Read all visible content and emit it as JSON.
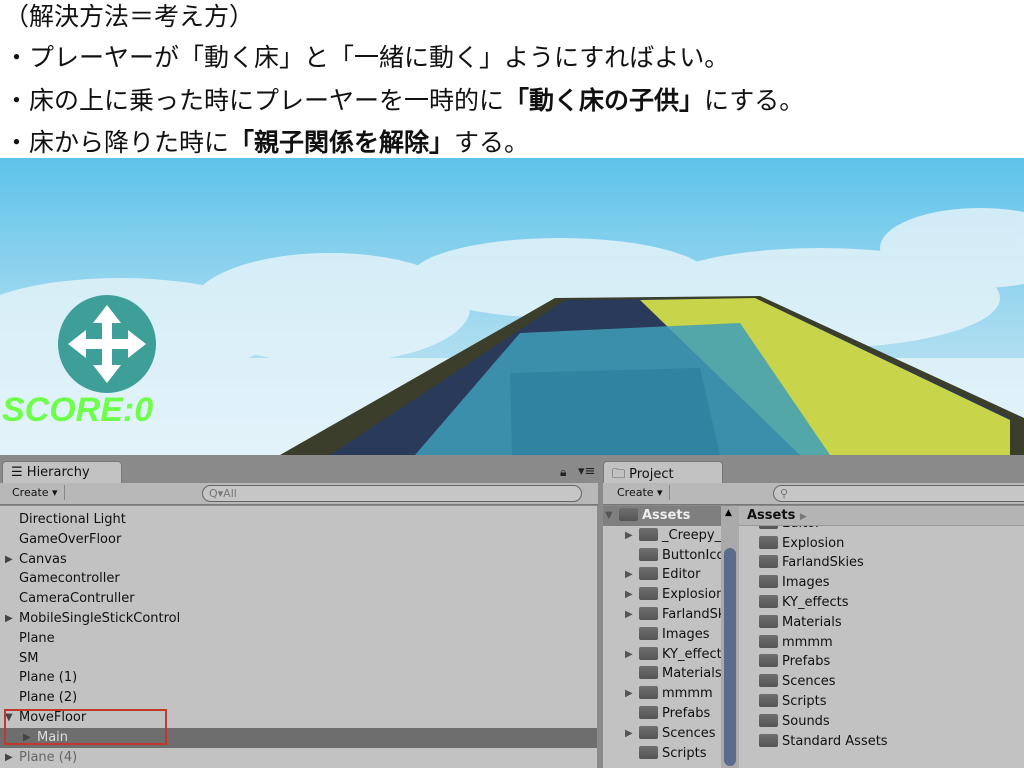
{
  "slide": {
    "lines": [
      {
        "plain": "（解決方法＝考え方）"
      },
      {
        "plain": "・プレーヤーが「動く床」と「一緒に動く」ようにすればよい。"
      },
      {
        "pre": "・床の上に乗った時にプレーヤーを一時的に",
        "bold": "「動く床の子供」",
        "post": "にする。"
      },
      {
        "pre": "・床から降りた時に",
        "bold": "「親子関係を解除」",
        "post": "する。"
      }
    ]
  },
  "game": {
    "score": "SCORE:0",
    "colors": {
      "sky": "#5ec3ea",
      "score": "#6dff4a",
      "button": "#3e9e98"
    }
  },
  "hierarchy": {
    "tab": "Hierarchy",
    "create": "Create",
    "search": "Q▾All",
    "items": [
      {
        "label": "Directional Light",
        "arrow": false
      },
      {
        "label": "GameOverFloor",
        "arrow": false
      },
      {
        "label": "Canvas",
        "arrow": true
      },
      {
        "label": "Gamecontroller",
        "arrow": false
      },
      {
        "label": "CameraContruller",
        "arrow": false
      },
      {
        "label": "MobileSingleStickControl",
        "arrow": true
      },
      {
        "label": "Plane",
        "arrow": false
      },
      {
        "label": "SM",
        "arrow": false
      },
      {
        "label": "Plane (1)",
        "arrow": false
      },
      {
        "label": "Plane (2)",
        "arrow": false
      },
      {
        "label": "MoveFloor",
        "arrow": true,
        "expanded": true
      },
      {
        "label": "Main",
        "arrow": true,
        "child": true,
        "selected": true
      },
      {
        "label": "Plane (4)",
        "arrow": true,
        "dim": true
      }
    ]
  },
  "project": {
    "tab": "Project",
    "create": "Create",
    "breadcrumb": "Assets",
    "tree": [
      {
        "label": "Assets",
        "root": true
      },
      {
        "label": "_Creepy_",
        "arrow": true
      },
      {
        "label": "ButtonIco",
        "arrow": false
      },
      {
        "label": "Editor",
        "arrow": true
      },
      {
        "label": "Explosion",
        "arrow": true
      },
      {
        "label": "FarlandSk",
        "arrow": true
      },
      {
        "label": "Images",
        "arrow": false
      },
      {
        "label": "KY_effect",
        "arrow": true
      },
      {
        "label": "Materials",
        "arrow": false
      },
      {
        "label": "mmmm",
        "arrow": true
      },
      {
        "label": "Prefabs",
        "arrow": false
      },
      {
        "label": "Scences",
        "arrow": true
      },
      {
        "label": "Scripts",
        "arrow": false
      }
    ],
    "folders": [
      "ButtonIcon",
      "Editor",
      "Explosion",
      "FarlandSkies",
      "Images",
      "KY_effects",
      "Materials",
      "mmmm",
      "Prefabs",
      "Scences",
      "Scripts",
      "Sounds",
      "Standard Assets"
    ]
  }
}
